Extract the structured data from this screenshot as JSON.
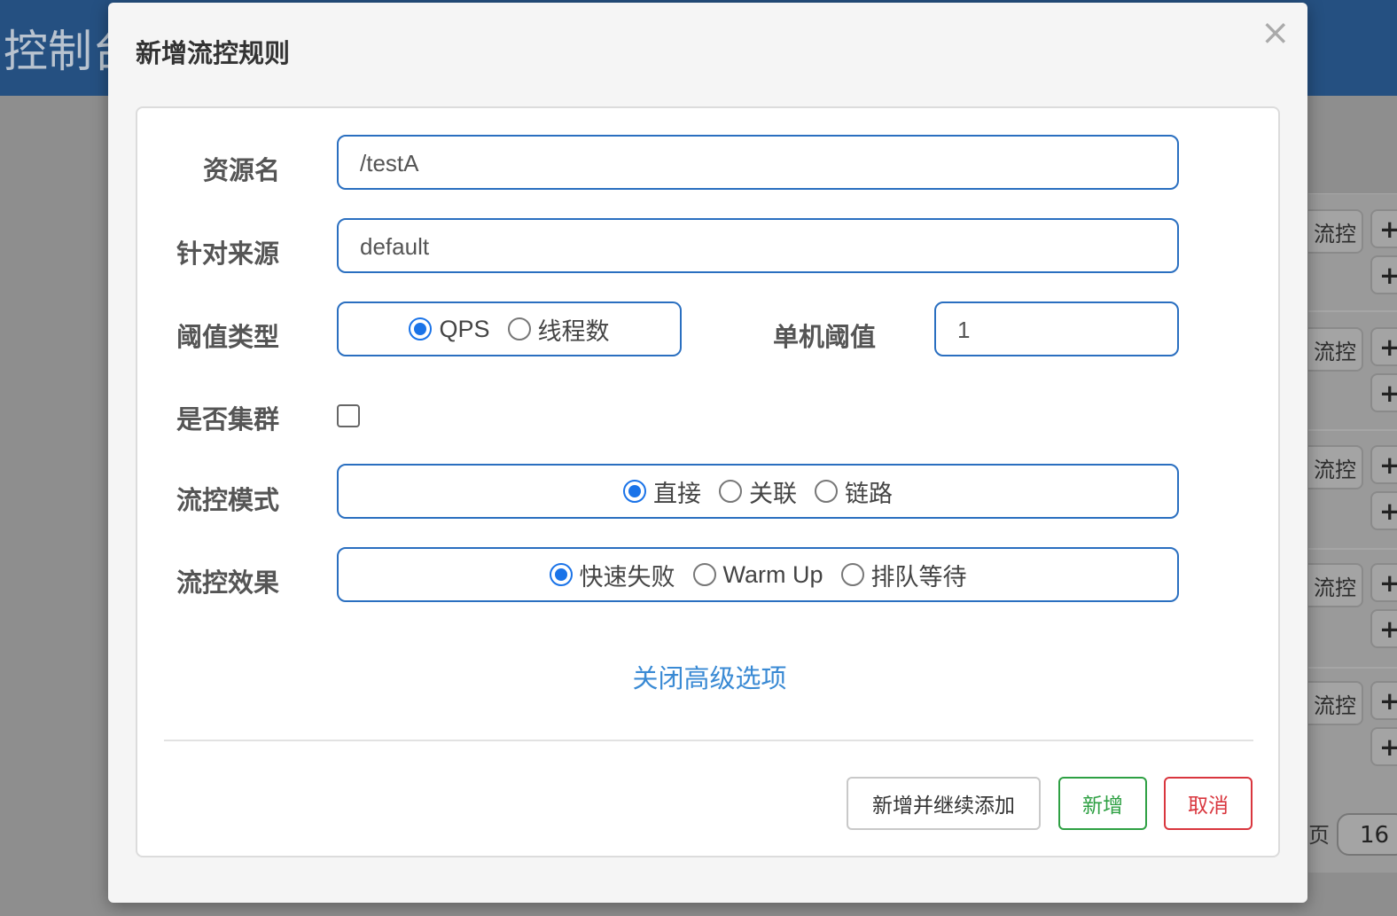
{
  "background": {
    "app_title": "控制台",
    "row_buttons": [
      "流控",
      "流控",
      "流控",
      "流控",
      "流控"
    ],
    "plus_glyph": "+",
    "page_label": "页",
    "page_size": "16"
  },
  "modal": {
    "title": "新增流控规则",
    "close_glyph": "×",
    "resource_name": {
      "label": "资源名",
      "value": "/testA"
    },
    "limit_app": {
      "label": "针对来源",
      "value": "default"
    },
    "threshold_type": {
      "label": "阈值类型",
      "options": [
        {
          "label": "QPS",
          "checked": true
        },
        {
          "label": "线程数",
          "checked": false
        }
      ]
    },
    "single_threshold": {
      "label": "单机阈值",
      "value": "1"
    },
    "cluster": {
      "label": "是否集群",
      "checked": false
    },
    "flow_mode": {
      "label": "流控模式",
      "options": [
        {
          "label": "直接",
          "checked": true
        },
        {
          "label": "关联",
          "checked": false
        },
        {
          "label": "链路",
          "checked": false
        }
      ]
    },
    "flow_effect": {
      "label": "流控效果",
      "options": [
        {
          "label": "快速失败",
          "checked": true
        },
        {
          "label": "Warm Up",
          "checked": false
        },
        {
          "label": "排队等待",
          "checked": false
        }
      ]
    },
    "advanced_link": "关闭高级选项",
    "buttons": {
      "add_continue": "新增并继续添加",
      "add": "新增",
      "cancel": "取消"
    }
  },
  "colors": {
    "header": "#255081",
    "accent": "#1a73e8",
    "success": "#2ea043",
    "danger": "#d9363e",
    "link": "#3a8ad4"
  }
}
